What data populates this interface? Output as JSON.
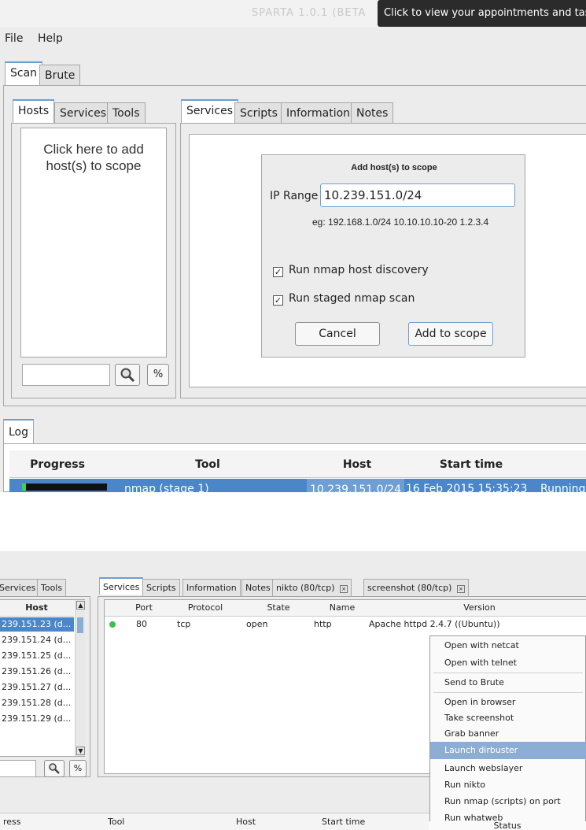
{
  "window": {
    "title": "SPARTA 1.0.1 (BETA",
    "tooltip": "Click to view your appointments and tas"
  },
  "menu": {
    "file": "File",
    "help": "Help"
  },
  "main_tabs": {
    "scan": "Scan",
    "brute": "Brute"
  },
  "left_tabs": {
    "hosts": "Hosts",
    "services": "Services",
    "tools": "Tools"
  },
  "hosts_panel": {
    "placeholder_text": "Click here to add host(s) to scope"
  },
  "right_tabs": {
    "services": "Services",
    "scripts": "Scripts",
    "information": "Information",
    "notes": "Notes"
  },
  "dialog": {
    "title": "Add host(s) to scope",
    "ip_label": "IP Range",
    "ip_value": "10.239.151.0/24",
    "example": "eg: 192.168.1.0/24 10.10.10.10-20 1.2.3.4",
    "check_discovery": "Run nmap host discovery",
    "check_staged": "Run staged nmap scan",
    "cancel": "Cancel",
    "add": "Add to scope"
  },
  "log": {
    "tab": "Log",
    "headers": [
      "Progress",
      "Tool",
      "Host",
      "Start time"
    ],
    "row": {
      "progress": 0.05,
      "tool": "nmap (stage 1)",
      "host": "10.239.151.0/24",
      "start": "16 Feb 2015 15:35:23",
      "status": "Running"
    }
  },
  "shot2": {
    "left_tabs": {
      "services": "Services",
      "tools": "Tools"
    },
    "host_header": "Host",
    "hosts": [
      "239.151.23 (d...",
      "239.151.24 (d...",
      "239.151.25 (d...",
      "239.151.26 (d...",
      "239.151.27 (d...",
      "239.151.28 (d...",
      "239.151.29 (d..."
    ],
    "right_tabs": {
      "services": "Services",
      "scripts": "Scripts",
      "information": "Information",
      "notes": "Notes",
      "nikto": "nikto (80/tcp)",
      "screenshot": "screenshot (80/tcp)"
    },
    "svc_headers": {
      "port": "Port",
      "protocol": "Protocol",
      "state": "State",
      "name": "Name",
      "version": "Version"
    },
    "svc_row": {
      "port": "80",
      "protocol": "tcp",
      "state": "open",
      "name": "http",
      "version": "Apache httpd 2.4.7 ((Ubuntu))"
    },
    "context_menu": [
      "Open with netcat",
      "Open with telnet",
      "Send to Brute",
      "Open in browser",
      "Take screenshot",
      "Grab banner",
      "Launch dirbuster",
      "Launch webslayer",
      "Run nikto",
      "Run nmap (scripts) on port",
      "Run whatweb"
    ],
    "bottom_headers": {
      "progress": "ress",
      "tool": "Tool",
      "host": "Host",
      "start": "Start time",
      "status": "Status"
    }
  },
  "colors": {
    "accent": "#3d7ac0",
    "selection": "#4a86c8",
    "progress_bg": "#111111",
    "progress_fill": "#3bd44a",
    "status_dot": "#3cc24a"
  }
}
